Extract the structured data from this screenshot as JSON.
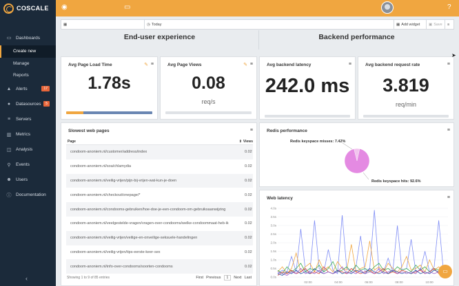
{
  "brand": {
    "name": "COSCALE"
  },
  "sidebar": {
    "items": [
      {
        "label": "Dashboards",
        "icon": "monitor-icon"
      },
      {
        "label": "Alerts",
        "icon": "warning-icon",
        "badge": "17"
      },
      {
        "label": "Datasources",
        "icon": "globe-icon",
        "badge": "5"
      },
      {
        "label": "Servers",
        "icon": "server-icon"
      },
      {
        "label": "Metrics",
        "icon": "chart-icon"
      },
      {
        "label": "Analysis",
        "icon": "analysis-icon"
      },
      {
        "label": "Events",
        "icon": "pin-icon"
      },
      {
        "label": "Users",
        "icon": "users-icon"
      },
      {
        "label": "Documentation",
        "icon": "info-icon"
      }
    ],
    "subitems": [
      "Create new",
      "Manage",
      "Reports"
    ]
  },
  "toolbar": {
    "today": "Today",
    "add_widget": "Add widget",
    "save": "Save"
  },
  "sections": {
    "left": "End-user experience",
    "right": "Backend performance"
  },
  "widgets": {
    "page_load": {
      "title": "Avg Page Load Time",
      "value": "1.78s"
    },
    "page_views": {
      "title": "Avg Page Views",
      "value": "0.08",
      "unit": "req/s"
    },
    "backend_latency": {
      "title": "Avg backend latency",
      "value": "242.0 ms"
    },
    "request_rate": {
      "title": "Avg backend request rate",
      "value": "3.819",
      "unit": "req/min"
    }
  },
  "slow_pages": {
    "title": "Slowest web pages",
    "columns": [
      "Page",
      "Views"
    ],
    "rows": [
      {
        "page": "condoom-anoniem.nl/customer/address/index",
        "views": "0.02"
      },
      {
        "page": "condoom-anoniem.nl/soa/chlamydia",
        "views": "0.02"
      },
      {
        "page": "condoom-anoniem.nl/veilig-vrijen/pijn-bij-vrijen-wat-kun-je-doen",
        "views": "0.02"
      },
      {
        "page": "condoom-anoniem.nl/checkout/onepage/*",
        "views": "0.02"
      },
      {
        "page": "condoom-anoniem.nl/condooms-gebruiken/hoe-doe-je-een-condoom-om-gebruiksaanwijzing",
        "views": "0.02"
      },
      {
        "page": "condoom-anoniem.nl/veelgestelde-vragen/vragen-over-condooms/welke-condoommaat-heb-ik",
        "views": "0.02"
      },
      {
        "page": "condoom-anoniem.nl/veilig-vrijen/veilige-en-onveilige-seksuele-handelingen",
        "views": "0.02"
      },
      {
        "page": "condoom-anoniem.nl/veilig-vrijen/tips-eerste-keer-sex",
        "views": "0.02"
      },
      {
        "page": "condoom-anoniem.nl/info-over-condooms/soorten-condooms",
        "views": "0.02"
      }
    ],
    "footer": "Showing 1 to 9 of 85 entries",
    "pager": {
      "first": "First",
      "previous": "Previous",
      "page": "1",
      "next": "Next",
      "last": "Last"
    }
  },
  "redis": {
    "title": "Redis performance",
    "misses_label": "Redis keyspace misses: 7.42%",
    "hits_label": "Redis keyspace hits: 92.6%"
  },
  "web_latency": {
    "title": "Web latency"
  },
  "chart_data": [
    {
      "type": "pie",
      "labels": [
        "Redis keyspace misses",
        "Redis keyspace hits"
      ],
      "values": [
        7.42,
        92.6
      ],
      "colors": [
        "#f2c4ee",
        "#e48ae2"
      ]
    },
    {
      "type": "line",
      "title": "Web latency",
      "yticks": [
        "0.0s",
        "0.5s",
        "1.0s",
        "1.5s",
        "2.0s",
        "2.5s",
        "3.0s",
        "3.5s",
        "4.0s"
      ],
      "xticks": [
        "02:00",
        "04:00",
        "06:00",
        "08:00",
        "10:00"
      ],
      "ylim": [
        0,
        4
      ],
      "series": [
        {
          "color": "#7e8cf5",
          "values": [
            0.2,
            0.4,
            0.3,
            1.2,
            0.3,
            2.8,
            0.4,
            0.3,
            3.3,
            0.5,
            0.3,
            1.6,
            0.4,
            0.2,
            3.6,
            0.5,
            0.3,
            0.6,
            2.4,
            0.3,
            0.5,
            3.9,
            0.4,
            0.3,
            1.1,
            0.3,
            3.0,
            0.4,
            0.5,
            2.2,
            0.3,
            0.4,
            1.5,
            0.3,
            0.6,
            3.3,
            0.4,
            0.5
          ]
        },
        {
          "color": "#f0a640",
          "values": [
            0.3,
            0.6,
            0.2,
            0.5,
            1.4,
            0.3,
            0.6,
            0.8,
            0.3,
            1.0,
            0.4,
            0.6,
            0.3,
            0.9,
            0.5,
            0.4,
            1.9,
            0.3,
            0.5,
            0.6,
            2.1,
            0.4,
            0.6,
            0.3,
            0.8,
            0.5,
            0.3,
            0.6,
            1.2,
            0.4,
            0.5,
            0.7,
            0.3,
            1.0,
            0.4,
            0.6,
            0.3,
            0.5
          ]
        },
        {
          "color": "#3fae5a",
          "values": [
            0.4,
            0.2,
            0.6,
            0.3,
            0.5,
            0.8,
            0.3,
            0.5,
            0.4,
            0.7,
            0.3,
            0.5,
            0.9,
            0.3,
            0.4,
            0.6,
            0.3,
            0.7,
            0.4,
            0.5,
            0.3,
            0.6,
            0.8,
            0.4,
            0.5,
            0.3,
            0.6,
            0.4,
            0.5,
            0.3,
            0.7,
            0.4,
            0.6,
            0.3,
            0.5,
            0.4,
            0.6,
            0.3
          ]
        },
        {
          "color": "#d9443a",
          "values": [
            0.1,
            0.3,
            0.2,
            0.4,
            0.2,
            0.3,
            0.5,
            0.2,
            0.3,
            0.2,
            0.6,
            0.3,
            0.2,
            0.4,
            0.3,
            0.2,
            0.5,
            0.3,
            0.2,
            0.3,
            0.4,
            0.2,
            0.3,
            0.5,
            0.2,
            0.3,
            0.2,
            0.4,
            0.3,
            0.2,
            0.3,
            0.4,
            0.2,
            0.3,
            0.5,
            0.2,
            0.3,
            0.2
          ]
        },
        {
          "color": "#2a5aa8",
          "values": [
            0.2,
            0.1,
            0.3,
            0.2,
            0.4,
            0.2,
            0.3,
            0.2,
            0.5,
            0.3,
            0.2,
            0.3,
            0.2,
            0.4,
            0.2,
            0.3,
            0.2,
            0.4,
            0.3,
            0.2,
            0.5,
            0.3,
            0.2,
            0.3,
            0.2,
            0.4,
            0.3,
            0.2,
            0.3,
            0.2,
            0.4,
            0.2,
            0.3,
            0.2,
            0.4,
            0.3,
            0.2,
            0.3
          ]
        },
        {
          "color": "#9a5cc8",
          "values": [
            0.3,
            0.2,
            0.1,
            0.3,
            0.2,
            0.5,
            0.2,
            0.3,
            0.2,
            0.4,
            0.2,
            0.3,
            0.2,
            0.3,
            0.6,
            0.2,
            0.3,
            0.2,
            0.4,
            0.2,
            0.3,
            0.2,
            0.5,
            0.2,
            0.3,
            0.4,
            0.2,
            0.3,
            0.2,
            0.3,
            0.2,
            0.5,
            0.2,
            0.3,
            0.2,
            0.3,
            0.2,
            0.4
          ]
        }
      ]
    }
  ]
}
